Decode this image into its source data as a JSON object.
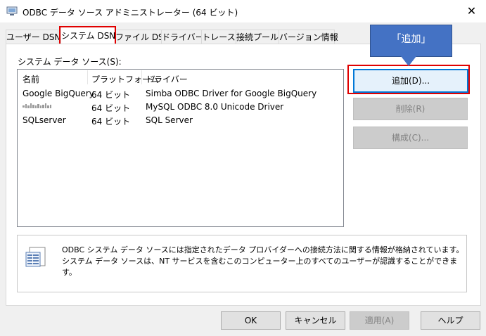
{
  "window": {
    "title": "ODBC データ ソース アドミニストレーター (64 ビット)",
    "close_symbol": "✕"
  },
  "tabs": [
    {
      "label": "ユーザー DSN"
    },
    {
      "label": "システム DSN"
    },
    {
      "label": "ファイル DSN"
    },
    {
      "label": "ドライバー"
    },
    {
      "label": "トレース"
    },
    {
      "label": "接続プール"
    },
    {
      "label": "バージョン情報"
    }
  ],
  "panel": {
    "list_label": "システム データ ソース(S):",
    "columns": {
      "name": "名前",
      "platform": "プラットフォーム",
      "driver": "ドライバー"
    },
    "rows": [
      {
        "name": "Google BigQuery",
        "platform": "64 ビット",
        "driver": "Simba ODBC Driver for Google BigQuery"
      },
      {
        "name": "",
        "platform": "64 ビット",
        "driver": "MySQL ODBC 8.0 Unicode Driver"
      },
      {
        "name": "SQLserver",
        "platform": "64 ビット",
        "driver": "SQL Server"
      }
    ],
    "buttons": {
      "add": "追加(D)...",
      "remove": "削除(R)",
      "configure": "構成(C)..."
    },
    "info_text": "ODBC システム データ ソースには指定されたデータ プロバイダーへの接続方法に関する情報が格納されています。システム データ ソースは、NT サービスを含むこのコンピューター上のすべてのユーザーが認識することができます。"
  },
  "callout": {
    "text": "「追加」"
  },
  "footer": {
    "ok": "OK",
    "cancel": "キャンセル",
    "apply": "適用(A)",
    "help": "ヘルプ"
  },
  "colors": {
    "highlight": "#e00000",
    "callout": "#4472c4",
    "focus": "#0078d7"
  }
}
